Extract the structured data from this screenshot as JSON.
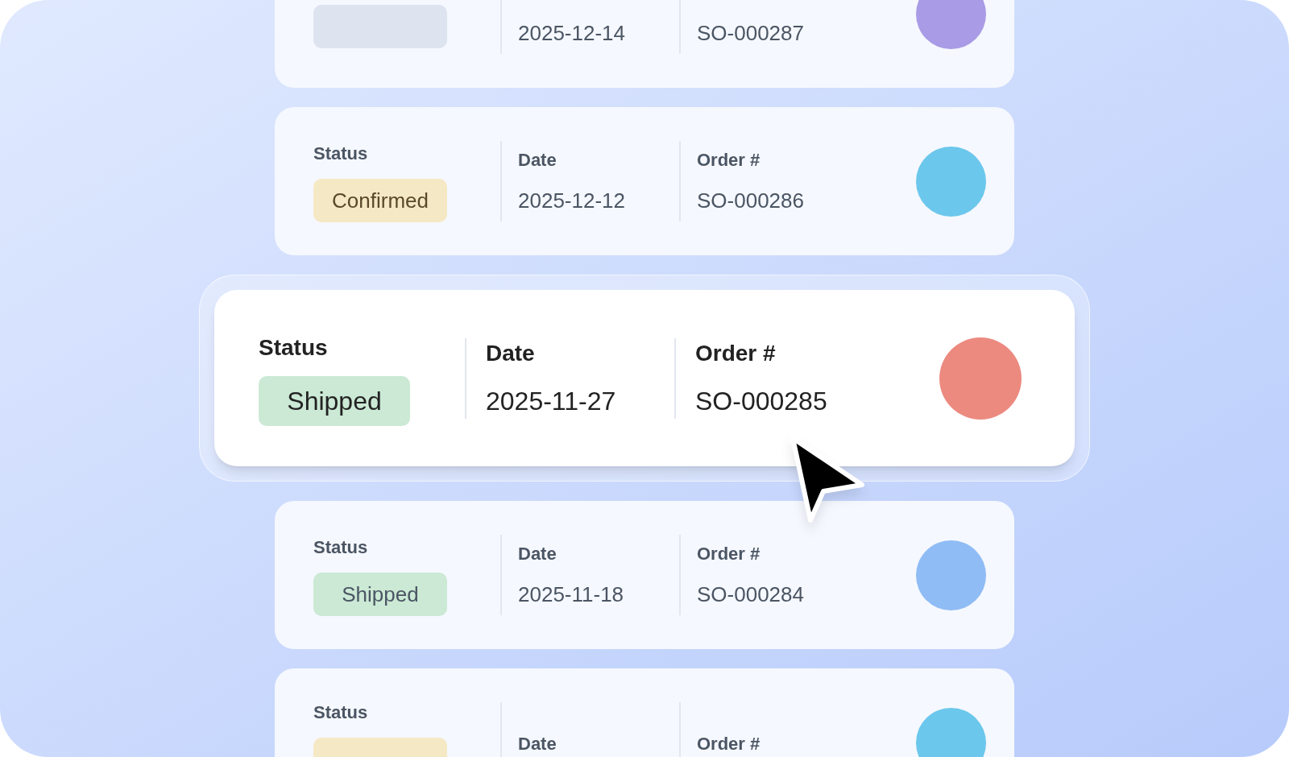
{
  "orders": [
    {
      "highlighted": false,
      "status": {
        "kind": "draft"
      },
      "date": {
        "value": "2025-12-14"
      },
      "order": {
        "value": "SO-000287"
      },
      "color": "#a99be6"
    },
    {
      "highlighted": false,
      "status": {
        "label": "Status",
        "kind": "confirmed",
        "value": "Confirmed"
      },
      "date": {
        "label": "Date",
        "value": "2025-12-12"
      },
      "order": {
        "label": "Order #",
        "value": "SO-000286"
      },
      "color": "#6cc7ec"
    },
    {
      "highlighted": true,
      "status": {
        "label": "Status",
        "kind": "shipped",
        "value": "Shipped"
      },
      "date": {
        "label": "Date",
        "value": "2025-11-27"
      },
      "order": {
        "label": "Order #",
        "value": "SO-000285"
      },
      "color": "#ec8a80"
    },
    {
      "highlighted": false,
      "status": {
        "label": "Status",
        "kind": "shipped",
        "value": "Shipped"
      },
      "date": {
        "label": "Date",
        "value": "2025-11-18"
      },
      "order": {
        "label": "Order #",
        "value": "SO-000284"
      },
      "color": "#8fbcf5"
    },
    {
      "highlighted": false,
      "status": {
        "label": "Status",
        "kind": "confirmed"
      },
      "date": {
        "label": "Date"
      },
      "order": {
        "label": "Order #"
      },
      "color": "#6cc7ec"
    }
  ]
}
